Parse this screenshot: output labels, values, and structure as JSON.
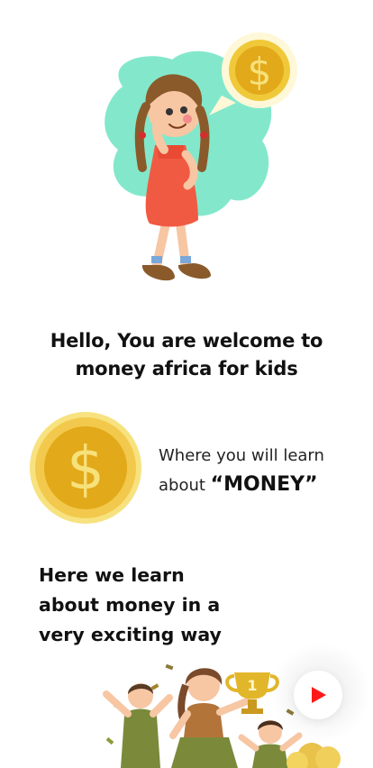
{
  "welcome": {
    "line1": "Hello, You are welcome to",
    "line2": "money africa for kids"
  },
  "learn": {
    "line1": "Where you will learn",
    "prefix": "about ",
    "highlight": "“MONEY”"
  },
  "exciting": {
    "line1": "Here we learn",
    "line2": "about money in a",
    "line3": "very exciting way"
  },
  "coin_symbol": "$",
  "trophy_number": "1",
  "icons": {
    "hero": "girl-thinking-illustration",
    "coin": "dollar-coin-icon",
    "celebrate": "kids-celebrating-illustration",
    "play": "play-icon"
  },
  "colors": {
    "accent_red": "#ff1a1a",
    "coin_gold": "#f2c94c",
    "coin_dark": "#e2a91a",
    "mint": "#83e8cb"
  }
}
